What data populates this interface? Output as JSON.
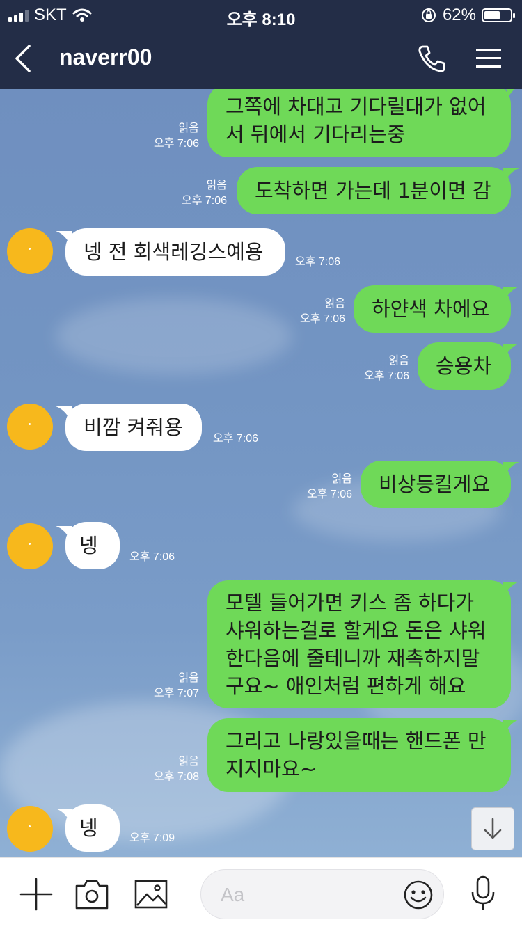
{
  "status_bar": {
    "carrier": "SKT",
    "time": "오후 8:10",
    "battery_percent": "62%",
    "battery_level": 0.62
  },
  "header": {
    "title": "naverr00",
    "icons": [
      "chevron-left-icon",
      "phone-icon",
      "menu-icon"
    ]
  },
  "messages": [
    {
      "side": "out",
      "text": "그쪽에 차대고 기다릴대가 없어\n서 뒤에서 기다리는중",
      "read": "읽음",
      "time": "오후 7:06"
    },
    {
      "side": "out",
      "text": "도착하면 가는데 1분이면 감",
      "read": "읽음",
      "time": "오후 7:06"
    },
    {
      "side": "in",
      "text": "넹 전 회색레깅스예용",
      "time": "오후 7:06"
    },
    {
      "side": "out",
      "text": "하얀색 차에요",
      "read": "읽음",
      "time": "오후 7:06"
    },
    {
      "side": "out",
      "text": "승용차",
      "read": "읽음",
      "time": "오후 7:06"
    },
    {
      "side": "in",
      "text": "비깜 켜줘용",
      "time": "오후 7:06"
    },
    {
      "side": "out",
      "text": "비상등킬게요",
      "read": "읽음",
      "time": "오후 7:06"
    },
    {
      "side": "in",
      "text": "넹",
      "time": "오후 7:06"
    },
    {
      "side": "out",
      "text": "모텔 들어가면 키스 좀 하다가\n샤워하는걸로 할게요 돈은 샤워\n한다음에 줄테니까 재촉하지말\n구요~ 애인처럼 편하게 해요",
      "read": "읽음",
      "time": "오후 7:07"
    },
    {
      "side": "out",
      "text": "그리고 나랑있을때는 핸드폰 만\n지지마요~",
      "read": "읽음",
      "time": "오후 7:08"
    },
    {
      "side": "in",
      "text": "넹",
      "time": "오후 7:09"
    }
  ],
  "input_bar": {
    "placeholder": "Aa",
    "icons": [
      "plus-icon",
      "camera-icon",
      "image-icon",
      "emoji-icon",
      "microphone-icon"
    ]
  },
  "colors": {
    "header_bg": "#232d47",
    "outgoing_bubble": "#6fd958",
    "incoming_bubble": "#ffffff",
    "avatar": "#f7b81c"
  }
}
